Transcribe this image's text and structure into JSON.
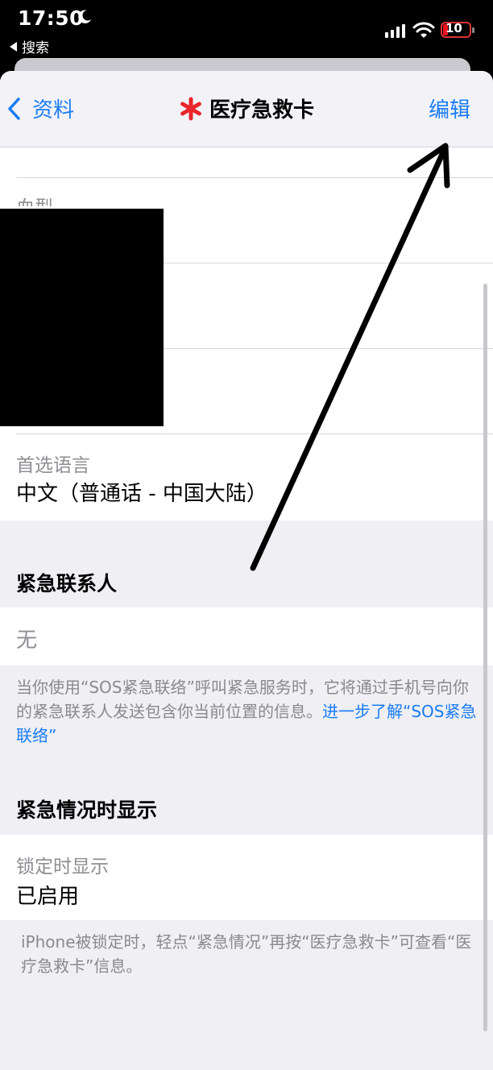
{
  "status_bar": {
    "time": "17:50",
    "back_app": "搜索",
    "battery": "10"
  },
  "nav": {
    "back_label": "资料",
    "title": "医疗急救卡",
    "edit_label": "编辑",
    "accent_color": "#1a7cf5",
    "title_icon": "red-asterisk-icon"
  },
  "fields": {
    "blood_type_label": "血型",
    "language_label": "首选语言",
    "language_value": "中文（普通话 - 中国大陆）"
  },
  "emergency_contacts": {
    "header": "紧急联系人",
    "value": "无",
    "footer_text": "当你使用“SOS紧急联络”呼叫紧急服务时，它将通过手机号向你的紧急联系人发送包含你当前位置的信息。",
    "footer_link": "进一步了解“SOS紧急联络”"
  },
  "show_when_locked": {
    "header": "紧急情况时显示",
    "label": "锁定时显示",
    "value": "已启用",
    "footer_text": "iPhone被锁定时，轻点“紧急情况”再按“医疗急救卡”可查看“医疗急救卡”信息。"
  }
}
